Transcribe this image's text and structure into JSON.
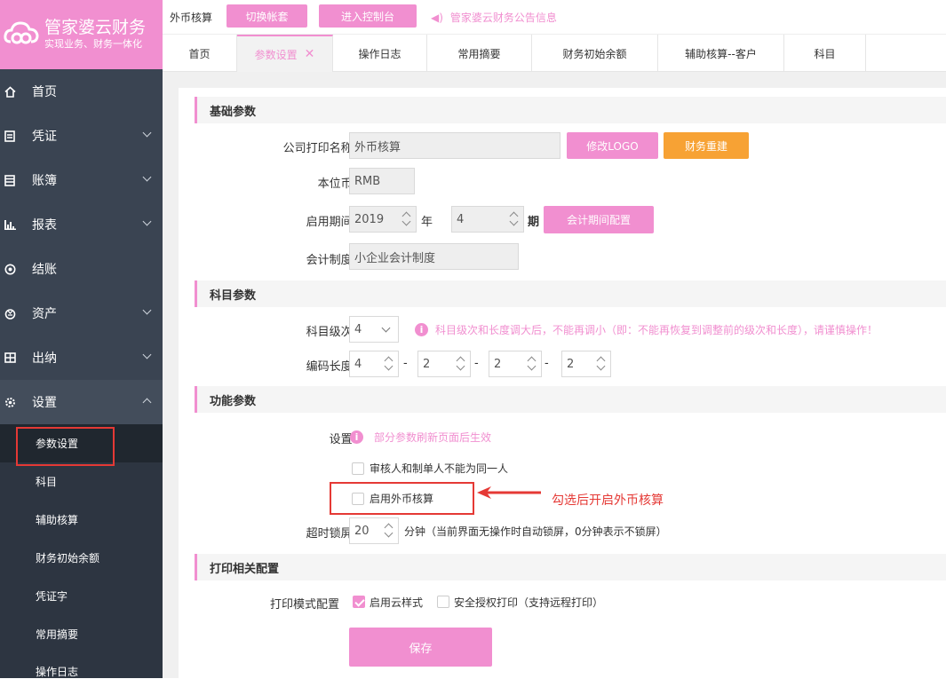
{
  "app": {
    "title": "管家婆云财务",
    "slogan": "实现业务、财务一体化"
  },
  "sidebar": {
    "items": [
      {
        "label": "首页",
        "icon": "home-icon"
      },
      {
        "label": "凭证",
        "icon": "voucher-icon"
      },
      {
        "label": "账簿",
        "icon": "ledger-icon"
      },
      {
        "label": "报表",
        "icon": "report-icon"
      },
      {
        "label": "结账",
        "icon": "close-account-icon"
      },
      {
        "label": "资产",
        "icon": "asset-icon"
      },
      {
        "label": "出纳",
        "icon": "cashier-icon"
      },
      {
        "label": "设置",
        "icon": "gear-icon"
      }
    ],
    "sub_items": [
      "参数设置",
      "科目",
      "辅助核算",
      "财务初始余额",
      "凭证字",
      "常用摘要",
      "操作日志"
    ]
  },
  "topbar": {
    "account": "外币核算",
    "switch_btn": "切换帐套",
    "console_btn": "进入控制台",
    "notice": "管家婆云财务公告信息"
  },
  "tabs": [
    "首页",
    "参数设置",
    "操作日志",
    "常用摘要",
    "财务初始余额",
    "辅助核算--客户",
    "科目"
  ],
  "basic": {
    "section": "基础参数",
    "company_label": "公司打印名称:",
    "company_value": "外币核算",
    "logo_btn": "修改LOGO",
    "rebuild_btn": "财务重建",
    "currency_label": "本位币:",
    "currency_value": "RMB",
    "period_label": "启用期间:",
    "year_value": "2019",
    "year_unit": "年",
    "period_value": "4",
    "period_unit": "期",
    "period_btn": "会计期间配置",
    "system_label": "会计制度:",
    "system_value": "小企业会计制度"
  },
  "subject": {
    "section": "科目参数",
    "level_label": "科目级次:",
    "level_value": "4",
    "warning": "科目级次和长度调大后，不能再调小（即：不能再恢复到调整前的级次和长度），请谨慎操作！",
    "code_label": "编码长度:",
    "code_values": [
      "4",
      "2",
      "2",
      "2"
    ],
    "sep": "-"
  },
  "func": {
    "section": "功能参数",
    "setting_label": "设置:",
    "refresh_note": "部分参数刷新页面后生效",
    "opt1": "审核人和制单人不能为同一人",
    "opt1_checked": false,
    "opt2": "启用外币核算",
    "opt2_checked": false,
    "annotation": "勾选后开启外币核算",
    "lock_label": "超时锁屏:",
    "lock_value": "20",
    "lock_note": "分钟（当前界面无操作时自动锁屏，0分钟表示不锁屏）"
  },
  "print": {
    "section": "打印相关配置",
    "mode_label": "打印模式配置",
    "cloud_style": "启用云样式",
    "cloud_checked": true,
    "secure_print": "安全授权打印（支持远程打印）",
    "secure_checked": false
  },
  "save_btn": "保存",
  "colors": {
    "accent": "#f18fd0",
    "sidebar": "#3a4452",
    "highlight": "#e53935",
    "orange": "#f7a234"
  }
}
